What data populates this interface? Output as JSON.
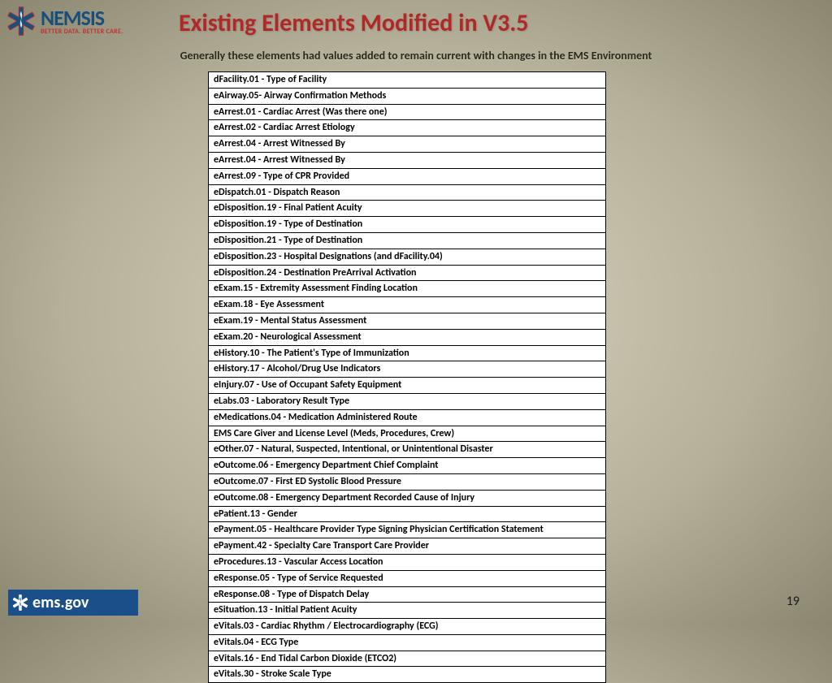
{
  "logo": {
    "main": "NEMSIS",
    "tagline": "BETTER DATA. BETTER CARE."
  },
  "title": "Existing Elements Modified in V3.5",
  "subtitle": "Generally these elements had values added to remain current with changes in the EMS Environment",
  "rows": [
    "dFacility.01 - Type of Facility",
    "eAirway.05- Airway Confirmation Methods",
    "eArrest.01 - Cardiac Arrest (Was there one)",
    "eArrest.02 - Cardiac Arrest Etiology",
    "eArrest.04 - Arrest Witnessed By",
    "eArrest.04 - Arrest Witnessed By",
    "eArrest.09 - Type of CPR Provided",
    "eDispatch.01 - Dispatch Reason",
    "eDisposition.19 - Final Patient Acuity",
    "eDisposition.19 - Type of Destination",
    "eDisposition.21 - Type of Destination",
    "eDisposition.23 - Hospital Designations (and dFacility.04)",
    "eDisposition.24 - Destination PreArrival Activation",
    "eExam.15 - Extremity Assessment Finding Location",
    "eExam.18 - Eye Assessment",
    "eExam.19 - Mental Status Assessment",
    "eExam.20 - Neurological Assessment",
    "eHistory.10 - The Patient's Type of Immunization",
    "eHistory.17 - Alcohol/Drug Use Indicators",
    "eInjury.07 - Use of Occupant Safety Equipment",
    "eLabs.03 - Laboratory Result Type",
    "eMedications.04 - Medication Administered Route",
    "EMS Care Giver and License Level (Meds, Procedures, Crew)",
    "eOther.07 - Natural, Suspected, Intentional, or Unintentional Disaster",
    "eOutcome.06 - Emergency Department Chief Complaint",
    "eOutcome.07 - First ED Systolic Blood Pressure",
    "eOutcome.08 - Emergency Department Recorded Cause of Injury",
    "ePatient.13 - Gender",
    "ePayment.05 - Healthcare Provider Type Signing Physician Certification Statement",
    "ePayment.42 - Specialty Care Transport Care Provider",
    "eProcedures.13 - Vascular Access Location",
    "eResponse.05 - Type of Service Requested",
    "eResponse.08 - Type of Dispatch Delay",
    "eSituation.13 - Initial Patient Acuity",
    "eVitals.03 - Cardiac Rhythm / Electrocardiography (ECG)",
    "eVitals.04 - ECG Type",
    "eVitals.16 - End Tidal Carbon Dioxide (ETCO2)",
    "eVitals.30 - Stroke Scale Type"
  ],
  "footer_logo": "ems.gov",
  "page_number": "19"
}
